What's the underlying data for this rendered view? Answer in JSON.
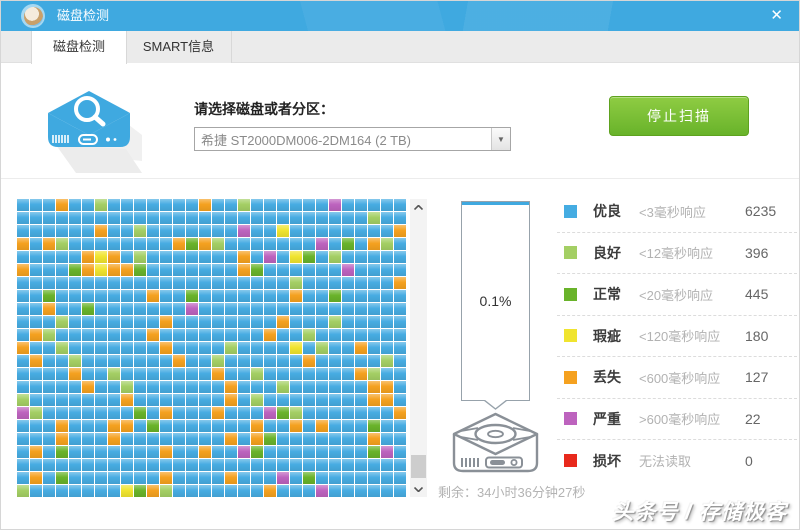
{
  "window": {
    "title": "磁盘检测",
    "close_icon": "✕"
  },
  "tabs": [
    {
      "label": "磁盘检测",
      "active": true
    },
    {
      "label": "SMART信息",
      "active": false
    }
  ],
  "header": {
    "select_label": "请选择磁盘或者分区：",
    "selected_disk": "希捷 ST2000DM006-2DM164  (2 TB)",
    "dropdown_arrow": "▼",
    "stop_button": "停止扫描",
    "button_color": "#68B32A"
  },
  "scan": {
    "columns": 30,
    "cell_colors": {
      "B": "#47ACE2",
      "L": "#A4CF64",
      "G": "#69B32A",
      "Y": "#F0E42F",
      "O": "#F5A11F",
      "P": "#BD63BE",
      "R": "#E8291C"
    },
    "rows": [
      "BBBOBBLBBBBBBBOBBLBBBBBBPBBBBB",
      "BBBBBBBBBBBBBBBBBBBBBBBBBBBLBB",
      "BBBBBBOBBLBBBBBBBPBBYBBBBBBBBO",
      "OBOLBBBBBBBBOGOLBBBBBBBPBGBOLB",
      "BBBBBOYOBLBBBBBBBOBPBYGBLBBBBB",
      "OBBBGOYOOGBBBBBBBOGBBBBBBPBBBB",
      "BBBBBBBBBBBBBBBBBBBBBLBBBBBBBO",
      "BBGBBBBBBBOBBGBBBBBBBOBBGBBBBB",
      "BBOBBGBBBBBBBPBBBBBBBBBBBBBBBB",
      "BBBLBBBBBBBOBBBBBBBBOBBBLBBBBB",
      "BOLBBBBBBBOBBBBBBBBOBBLBBBBBBB",
      "OBBLBBBBBBBOBBBBLBBBBYBLBBOBBB",
      "BOBBLBBBBBBBOBBLBBBBBBOBBBBBLB",
      "BBBBOBBLBBBBBBBOBBLBBBBBBBOLBB",
      "BBBBBOBBLBBBBBBBOBBBLBBBBBBOOB",
      "LBBBBBBBOBBBBBBBOBLBBBBBBBBOOB",
      "PLBBBBBBBGBOBBBOBBBPGLBBBBBBBO",
      "BBBOBBBOOBGBBBBBBBOBBOBOBBBGBB",
      "BBBOBBBOBBBBBBBBOBOGBBBBBBBOBB",
      "BOBGBBBBBBBOBBOBBPGBBBBBBBBGPB",
      "BBBBBBBBBBBBBBBBBBBBBBBBBBBBBB",
      "BOBGBBBBBBBOBBBBOBBBPBGBBBBBBB",
      "LBBBBBBBYGOLBBBBBBBOBBBPBBBBBB"
    ]
  },
  "progress": {
    "percent": "0.1%",
    "fill_color": "#3FA9E0",
    "remaining": "剩余：34小时36分钟27秒"
  },
  "legend": {
    "items": [
      {
        "key": "excellent",
        "color": "#45ACE2",
        "label": "优良",
        "desc": "<3毫秒响应",
        "count": "6235"
      },
      {
        "key": "good",
        "color": "#A4CF64",
        "label": "良好",
        "desc": "<12毫秒响应",
        "count": "396"
      },
      {
        "key": "normal",
        "color": "#69B32A",
        "label": "正常",
        "desc": "<20毫秒响应",
        "count": "445"
      },
      {
        "key": "flaw",
        "color": "#F0E42F",
        "label": "瑕疵",
        "desc": "<120毫秒响应",
        "count": "180"
      },
      {
        "key": "lost",
        "color": "#F5A11F",
        "label": "丢失",
        "desc": "<600毫秒响应",
        "count": "127"
      },
      {
        "key": "severe",
        "color": "#BD63BE",
        "label": "严重",
        "desc": ">600毫秒响应",
        "count": "22"
      },
      {
        "key": "damaged",
        "color": "#E8291C",
        "label": "损坏",
        "desc": "无法读取",
        "count": "0"
      }
    ]
  },
  "watermark": "头条号 / 存储极客"
}
